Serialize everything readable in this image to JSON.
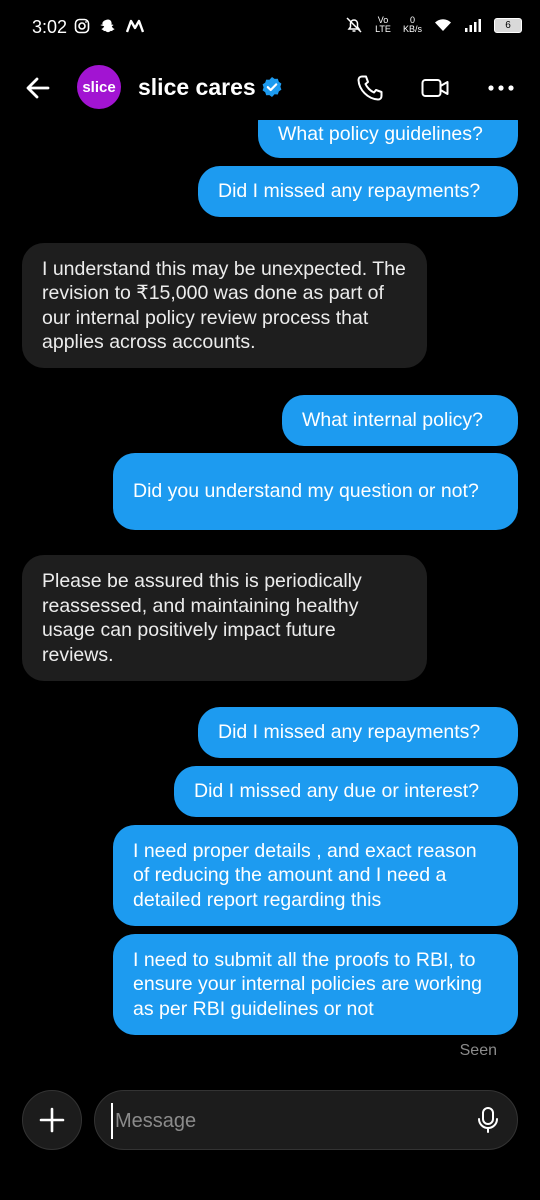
{
  "status_bar": {
    "time": "3:02",
    "network_label": "Vo LTE",
    "speed_value": "0",
    "speed_unit": "KB/s",
    "battery": "6"
  },
  "header": {
    "avatar_text": "slice",
    "title": "slice cares",
    "icons": [
      "back-arrow-icon",
      "verified-icon",
      "phone-icon",
      "video-icon",
      "more-icon"
    ],
    "avatar_color": "#a214d2",
    "verified_color": "#1d9bf0"
  },
  "messages": [
    {
      "side": "out",
      "text": "What policy guidelines?"
    },
    {
      "side": "out",
      "text": "Did I missed any repayments?"
    },
    {
      "side": "in",
      "text": "I understand this may be unexpected. The revision to ₹15,000 was done as part of our internal policy review process that applies across accounts."
    },
    {
      "side": "out",
      "text": "What internal policy?"
    },
    {
      "side": "out",
      "text": "Did you understand my question or not?"
    },
    {
      "side": "in",
      "text": "Please be assured this is periodically reassessed, and maintaining healthy usage can positively impact future reviews."
    },
    {
      "side": "out",
      "text": "Did I missed any repayments?"
    },
    {
      "side": "out",
      "text": "Did I missed any due or interest?"
    },
    {
      "side": "out",
      "text": "I need proper details , and exact reason of reducing the amount and I need a detailed report regarding this"
    },
    {
      "side": "out",
      "text": "I need to submit all the proofs to RBI, to ensure your internal policies are working as per RBI guidelines or not"
    }
  ],
  "seen_label": "Seen",
  "composer": {
    "placeholder": "Message",
    "value": ""
  },
  "colors": {
    "outgoing_bubble": "#1d9bf0",
    "incoming_bubble": "#1e1e1e",
    "background": "#000000"
  }
}
